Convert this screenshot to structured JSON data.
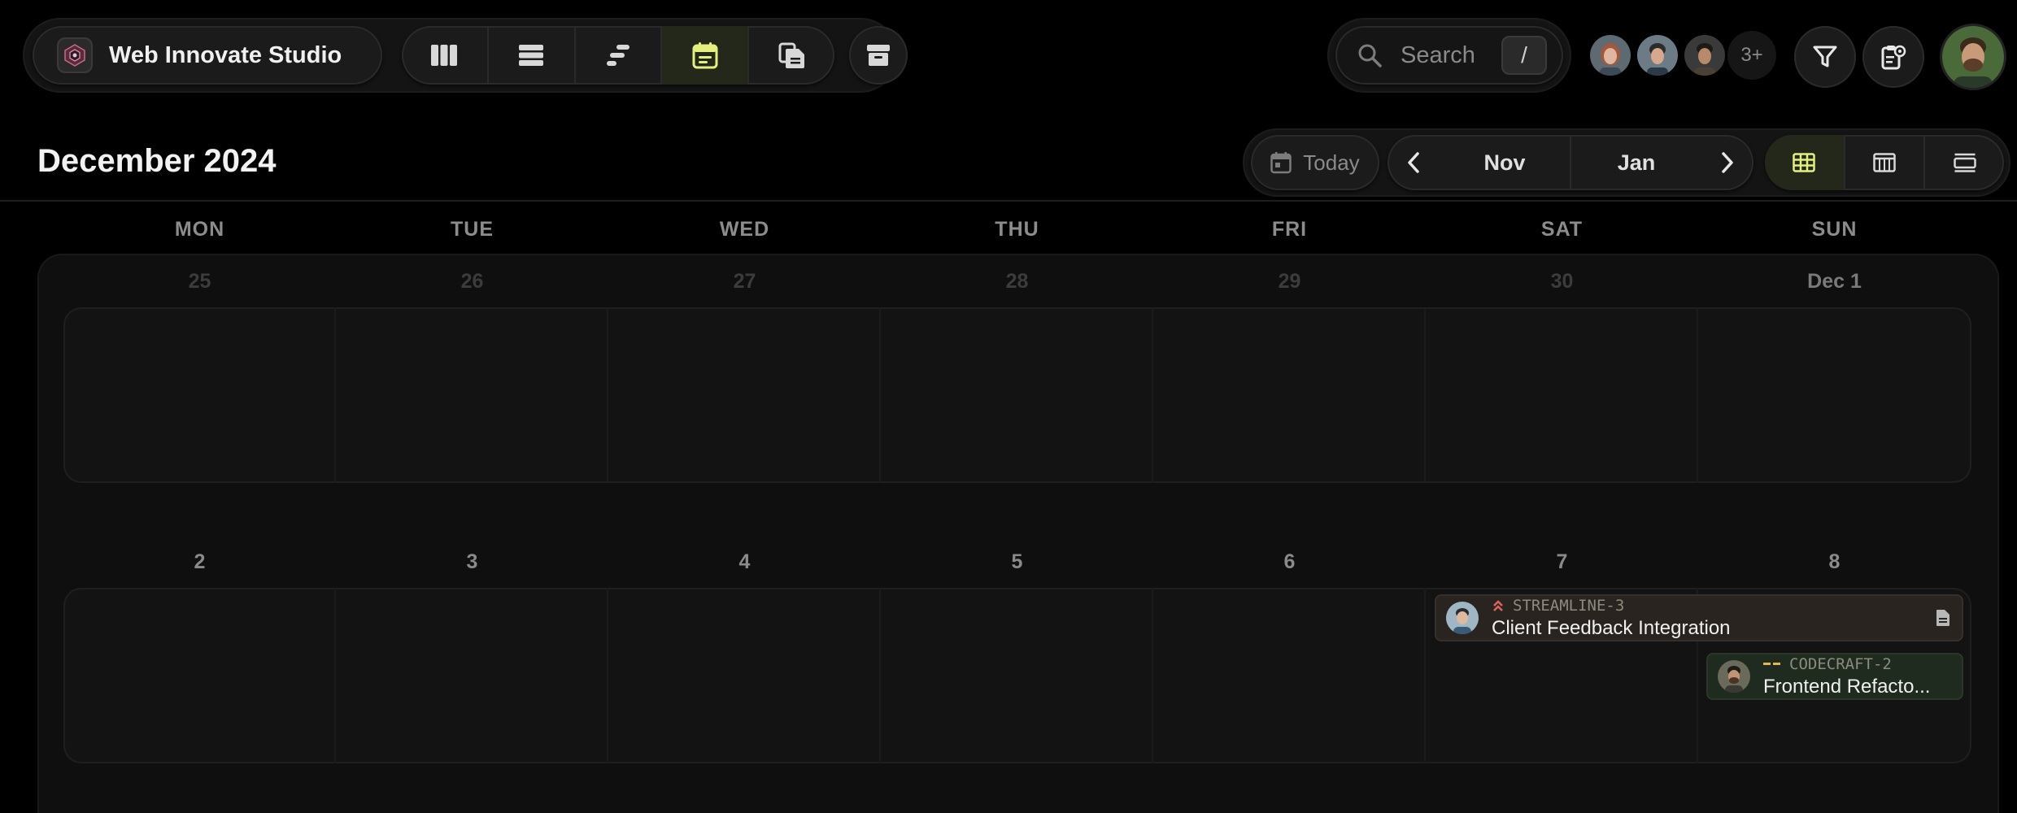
{
  "workspace": {
    "name": "Web Innovate Studio"
  },
  "toolbar": {
    "views": [
      {
        "name": "board-view",
        "icon": "columns-icon"
      },
      {
        "name": "list-view",
        "icon": "list-icon"
      },
      {
        "name": "timeline-view",
        "icon": "timeline-icon"
      },
      {
        "name": "calendar-view",
        "icon": "calendar-icon",
        "active": true
      },
      {
        "name": "documents-view",
        "icon": "documents-icon"
      }
    ],
    "archive_icon": "archive-icon",
    "active_color": "#e3f07a"
  },
  "search": {
    "placeholder": "Search",
    "shortcut": "/"
  },
  "members": {
    "more_label": "3+"
  },
  "header": {
    "title": "December 2024",
    "today_label": "Today",
    "prev_month": "Nov",
    "next_month": "Jan"
  },
  "calendar": {
    "weekdays": [
      "MON",
      "TUE",
      "WED",
      "THU",
      "FRI",
      "SAT",
      "SUN"
    ],
    "weeks": [
      {
        "days": [
          "25",
          "26",
          "27",
          "28",
          "29",
          "30",
          "Dec 1"
        ]
      },
      {
        "days": [
          "2",
          "3",
          "4",
          "5",
          "6",
          "7",
          "8"
        ]
      }
    ],
    "events": [
      {
        "key": "STREAMLINE-3",
        "title": "Client Feedback Integration",
        "priority": "high",
        "priority_color": "#d9655c",
        "bg": "#2a2420"
      },
      {
        "key": "CODECRAFT-2",
        "title": "Frontend Refacto...",
        "priority": "medium",
        "priority_color": "#e2b84c",
        "bg": "#1f2b1e"
      }
    ]
  }
}
